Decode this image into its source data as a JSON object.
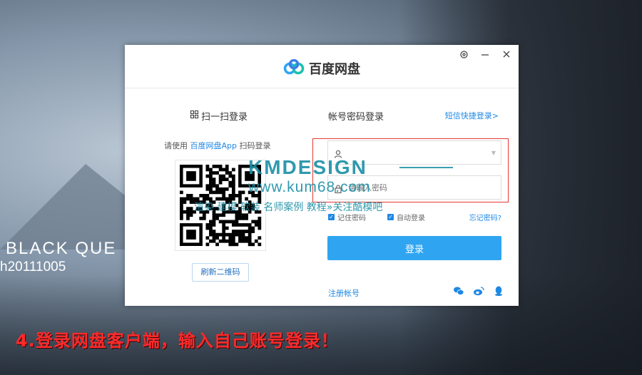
{
  "background": {
    "title": "BLACK QUE",
    "subtitle": "h20111005"
  },
  "caption": "4.登录网盘客户端，输入自己账号登录！",
  "dialog": {
    "app_name": "百度网盘",
    "icons": {
      "settings": "gear-icon",
      "minimize": "minimize-icon",
      "close": "close-icon"
    },
    "qr": {
      "title": "扫一扫登录",
      "hint_prefix": "请使用 ",
      "hint_app": "百度网盘App",
      "hint_suffix": " 扫码登录",
      "refresh_label": "刷新二维码"
    },
    "account": {
      "title": "帐号密码登录",
      "sms_link": "短信快捷登录>",
      "username_placeholder": "",
      "password_placeholder": "请输入密码",
      "remember_label": "记住密码",
      "auto_login_label": "自动登录",
      "forgot_label": "忘记密码?",
      "login_label": "登录",
      "register_label": "注册帐号"
    },
    "colors": {
      "accent": "#2fa5f1",
      "link": "#1e88e5"
    }
  },
  "watermark": {
    "brand": "KMDESIGN",
    "url": "www.kum68.com",
    "tagline": "渲染 建模 软装 名师案例 教程»关注酷模吧"
  }
}
